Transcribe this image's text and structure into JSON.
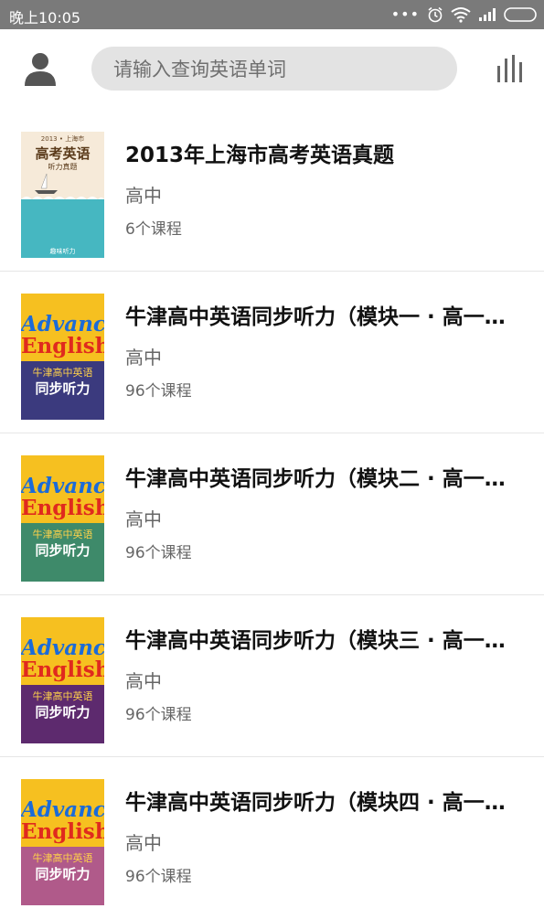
{
  "status_bar": {
    "time": "晚上10:05"
  },
  "search": {
    "placeholder": "请输入查询英语单词"
  },
  "colors": {
    "status_bar": "#7a7a7a",
    "search_bg": "#e3e3e3",
    "icon": "#555555"
  },
  "courses": [
    {
      "title": "2013年上海市高考英语真题",
      "level": "高中",
      "count": "6个课程",
      "cover": {
        "top": "2013 • 上海市",
        "main": "高考英语",
        "sub": "听力真题",
        "bottom": "趣味听力"
      }
    },
    {
      "title": "牛津高中英语同步听力（模块一 · 高一…",
      "level": "高中",
      "count": "96个课程",
      "cover": {
        "brand1": "Advance",
        "brand2": "English",
        "cn1": "牛津高中英语",
        "cn2": "同步听力",
        "color": "#3b3a7e"
      }
    },
    {
      "title": "牛津高中英语同步听力（模块二 · 高一…",
      "level": "高中",
      "count": "96个课程",
      "cover": {
        "brand1": "Advance",
        "brand2": "English",
        "cn1": "牛津高中英语",
        "cn2": "同步听力",
        "color": "#3e8a6a"
      }
    },
    {
      "title": "牛津高中英语同步听力（模块三 · 高一…",
      "level": "高中",
      "count": "96个课程",
      "cover": {
        "brand1": "Advance",
        "brand2": "English",
        "cn1": "牛津高中英语",
        "cn2": "同步听力",
        "color": "#5d2a6e"
      }
    },
    {
      "title": "牛津高中英语同步听力（模块四 · 高一…",
      "level": "高中",
      "count": "96个课程",
      "cover": {
        "brand1": "Advance",
        "brand2": "English",
        "cn1": "牛津高中英语",
        "cn2": "同步听力",
        "color": "#b05a8a"
      }
    }
  ]
}
